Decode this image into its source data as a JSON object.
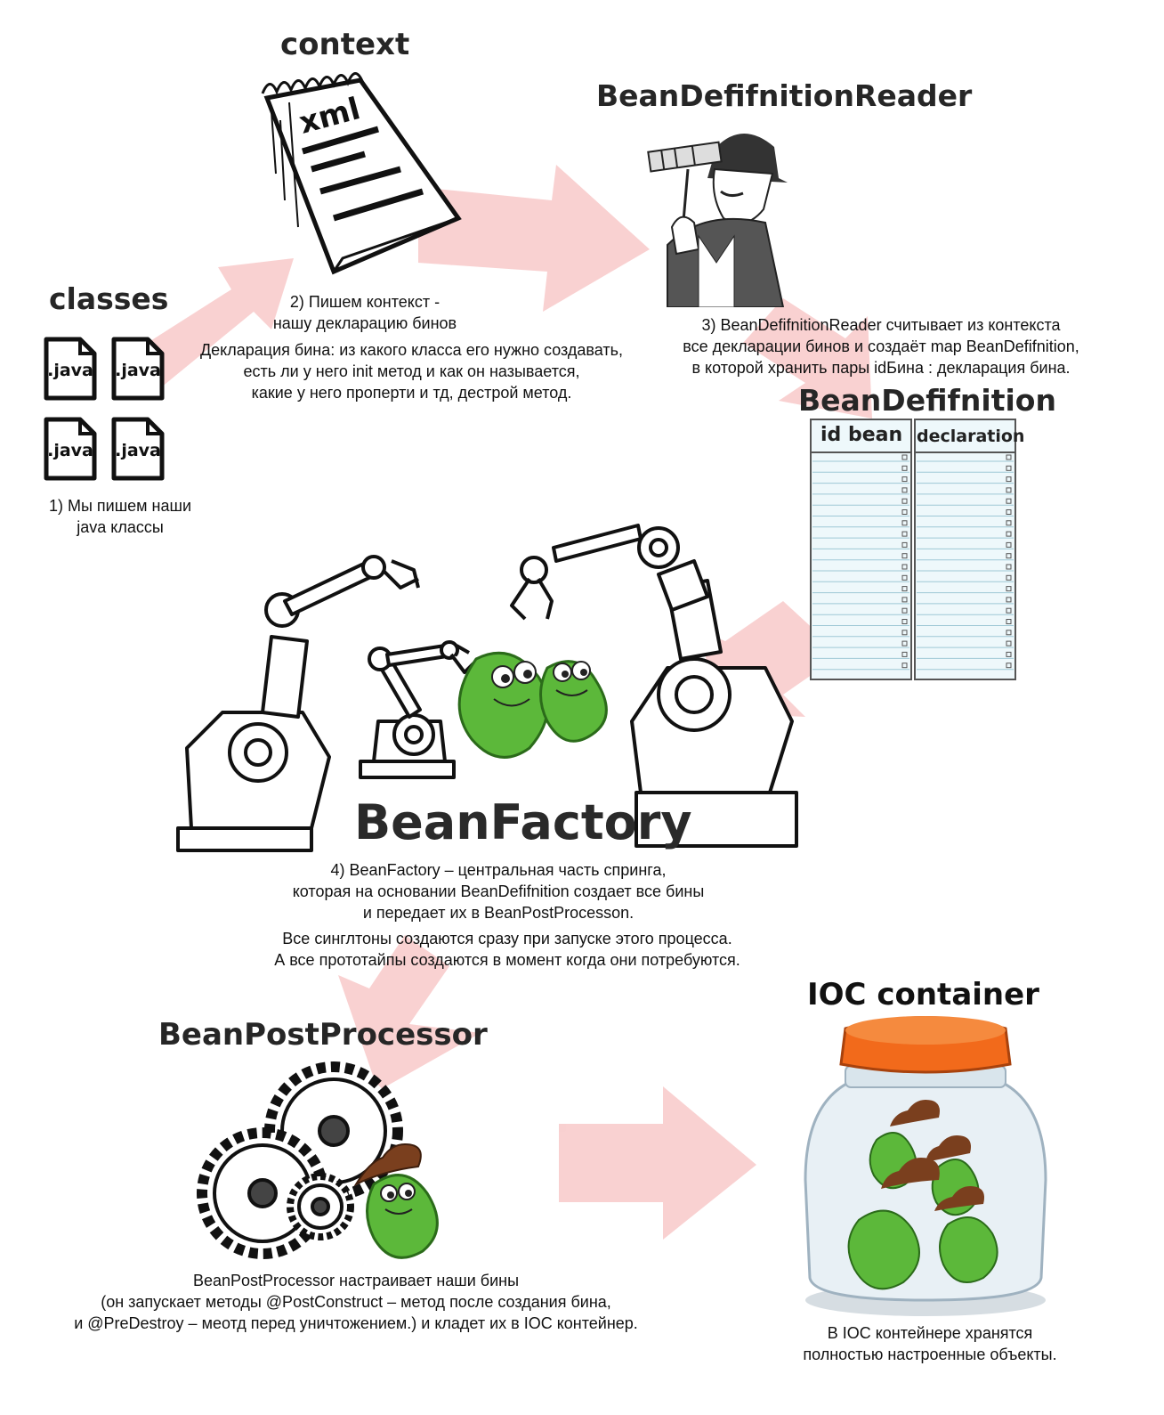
{
  "titles": {
    "context": "context",
    "reader": "BeanDefifnitionReader",
    "classes": "classes",
    "definition": "BeanDefifnition",
    "factory": "BeanFactory",
    "postprocessor": "BeanPostProcessor",
    "ioc": "IOC container"
  },
  "context_illustration": {
    "label": "xml"
  },
  "files": [
    ".java",
    ".java",
    ".java",
    ".java"
  ],
  "table": {
    "col1": "id bean",
    "col2": "declaration"
  },
  "descriptions": {
    "step1": [
      "1) Мы пишем наши",
      "java классы"
    ],
    "step2": [
      "2) Пишем контекст -",
      "нашу декларацию бинов"
    ],
    "step2_detail": [
      "Декларация бина: из какого класса его нужно создавать,",
      "есть ли у него init метод и как он называется,",
      "какие у него проперти и тд, дестрой метод."
    ],
    "step3": [
      "3) BeanDefifnitionReader считывает из контекста",
      "все декларации бинов и создаёт map BeanDefifnition,",
      "в которой хранить пары idБина : декларация бина."
    ],
    "step4": [
      "4) BeanFactory – центральная часть спринга,",
      "которая на основании BeanDefifnition создает все бины",
      "и передает их в BeanPostProcesson."
    ],
    "step4_detail": [
      "Все синглтоны создаются сразу при запуске этого процесса.",
      "А все прототайпы создаются в момент когда они потребуются."
    ],
    "postprocessor": [
      "BeanPostProcessor настраивает наши бины",
      "(он запускает методы @PostConstruct – метод после создания бина,",
      "и @PreDestroy – меотд перед уничтожением.) и кладет их в IOC контейнер."
    ],
    "ioc": [
      "В IOC контейнере хранятся",
      "полностью настроенные объекты."
    ]
  },
  "colors": {
    "arrow": "#f7c9c9",
    "bean": "#5cb83a",
    "lid": "#f26a1b",
    "hat": "#7a3f1e"
  }
}
